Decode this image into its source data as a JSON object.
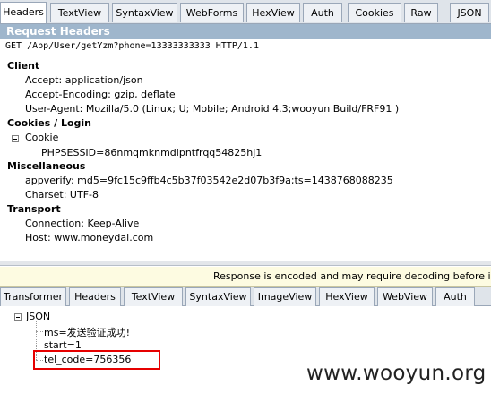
{
  "top_tabs": [
    "Headers",
    "TextView",
    "SyntaxView",
    "WebForms",
    "HexView",
    "Auth",
    "Cookies",
    "Raw",
    "JSON"
  ],
  "request_headers": {
    "title": "Request Headers",
    "request_line": "GET /App/User/getYzm?phone=13333333333 HTTP/1.1",
    "client": {
      "label": "Client",
      "items": [
        "Accept: application/json",
        "Accept-Encoding: gzip, deflate",
        "User-Agent: Mozilla/5.0 (Linux; U; Mobile; Android 4.3;wooyun Build/FRF91 )"
      ]
    },
    "cookies": {
      "label": "Cookies / Login",
      "cookie_node": "Cookie",
      "value": "PHPSESSID=86nmqmknmdipntfrqq54825hj1"
    },
    "misc": {
      "label": "Miscellaneous",
      "items": [
        "appverify: md5=9fc15c9ffb4c5b37f03542e2d07b3f9a;ts=1438768088235",
        "Charset: UTF-8"
      ]
    },
    "transport": {
      "label": "Transport",
      "items": [
        "Connection: Keep-Alive",
        "Host: www.moneydai.com"
      ]
    }
  },
  "response_notice": "Response is encoded and may require decoding before inspe",
  "bottom_tabs": [
    "Transformer",
    "Headers",
    "TextView",
    "SyntaxView",
    "ImageView",
    "HexView",
    "WebView",
    "Auth"
  ],
  "json_tree": {
    "root": "JSON",
    "children": [
      "ms=发送验证成功!",
      "start=1",
      "tel_code=756356"
    ]
  },
  "watermark": "www.wooyun.org"
}
